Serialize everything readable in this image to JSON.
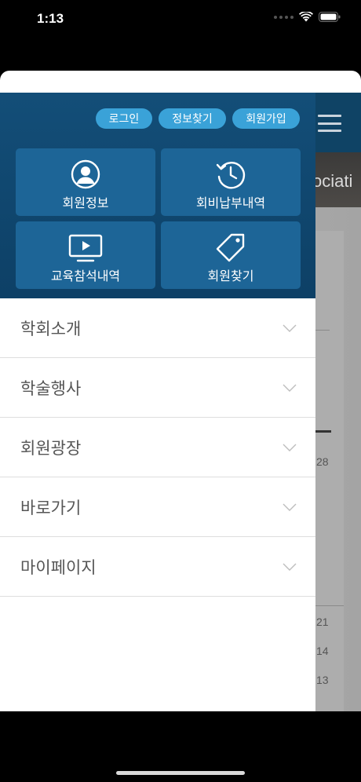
{
  "status_bar": {
    "time": "1:13"
  },
  "background": {
    "banner_text": "ociati",
    "numbers": [
      "28",
      "21",
      "14",
      "13"
    ]
  },
  "drawer": {
    "top_buttons": {
      "login": "로그인",
      "find_info": "정보찾기",
      "join": "회원가입"
    },
    "tiles": [
      {
        "label": "회원정보",
        "icon": "user-profile-icon"
      },
      {
        "label": "회비납부내역",
        "icon": "history-icon"
      },
      {
        "label": "교육참석내역",
        "icon": "video-monitor-icon"
      },
      {
        "label": "회원찾기",
        "icon": "tag-icon"
      }
    ],
    "menu": [
      {
        "label": "학회소개"
      },
      {
        "label": "학술행사"
      },
      {
        "label": "회원광장"
      },
      {
        "label": "바로가기"
      },
      {
        "label": "마이페이지"
      }
    ]
  },
  "colors": {
    "drawer_header": "#134e78",
    "tile": "#1d6597",
    "pill": "#3aa2d8"
  }
}
